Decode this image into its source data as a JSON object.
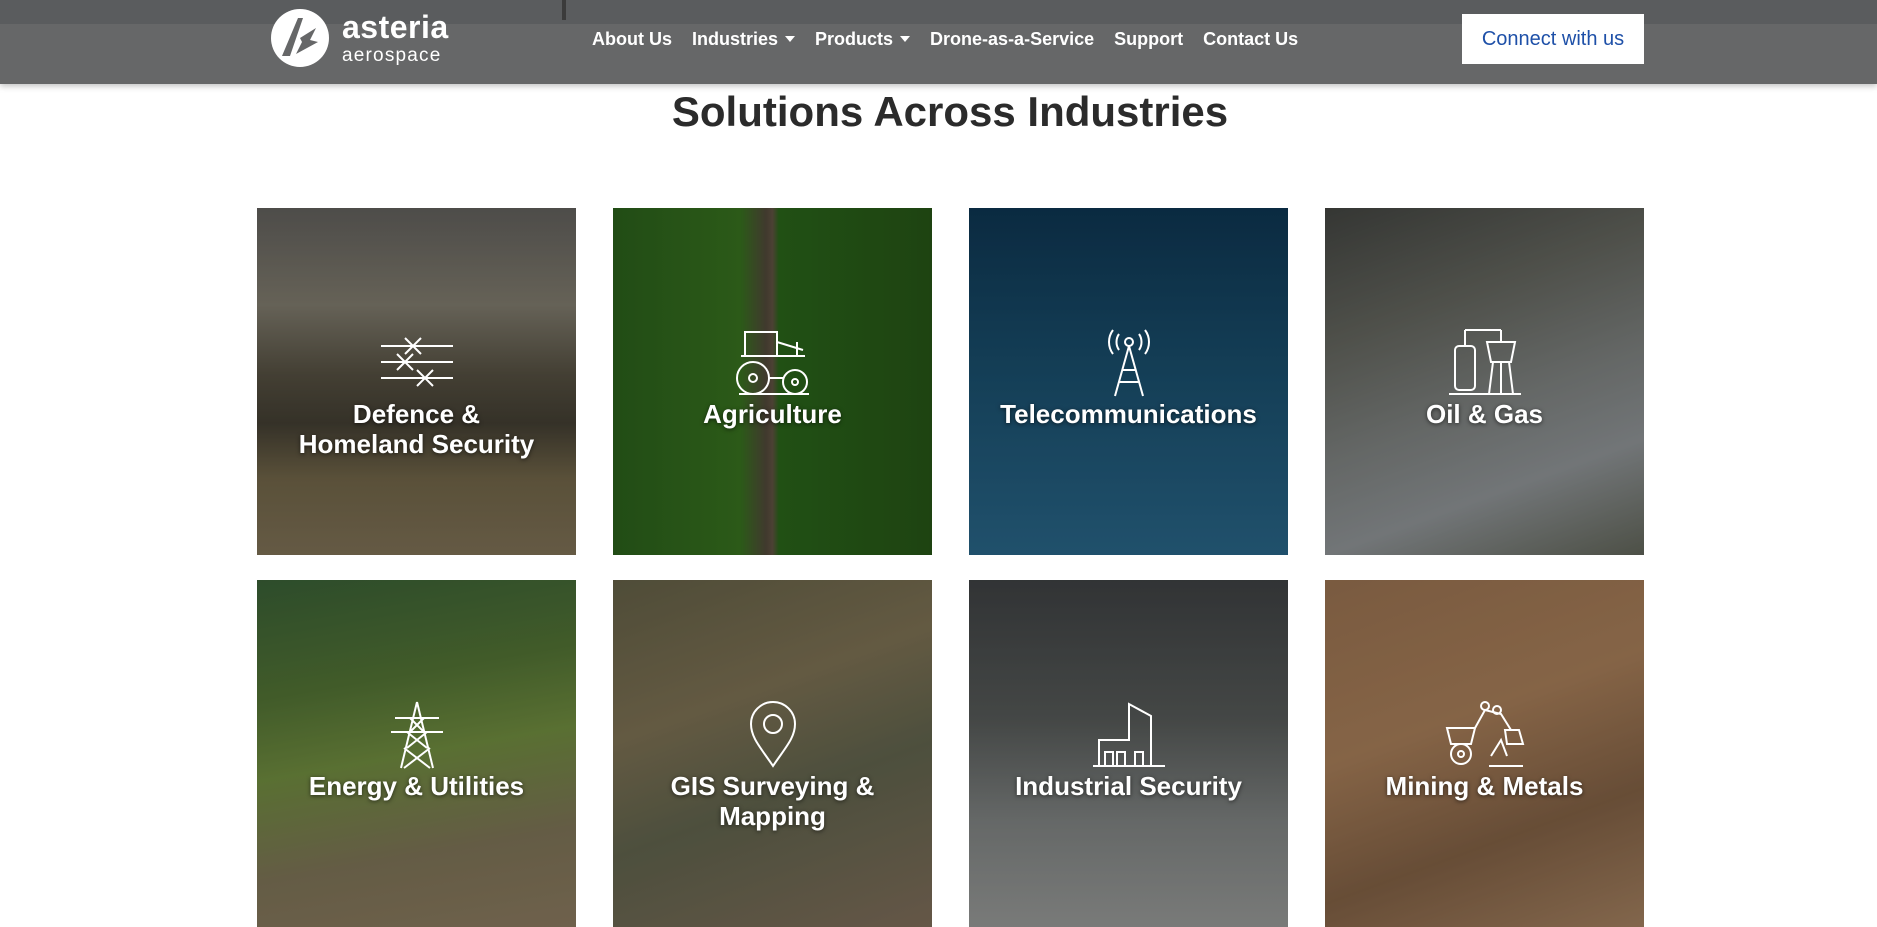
{
  "header": {
    "logo": {
      "name": "asteria",
      "sub": "aerospace"
    },
    "nav": [
      {
        "label": "About Us",
        "has_dropdown": false
      },
      {
        "label": "Industries",
        "has_dropdown": true
      },
      {
        "label": "Products",
        "has_dropdown": true
      },
      {
        "label": "Drone-as-a-Service",
        "has_dropdown": false
      },
      {
        "label": "Support",
        "has_dropdown": false
      },
      {
        "label": "Contact Us",
        "has_dropdown": false
      }
    ],
    "cta_label": "Connect with us"
  },
  "section": {
    "title": "Solutions Across Industries",
    "tiles": [
      {
        "label_line1": "Defence &",
        "label_line2": "Homeland Security",
        "icon": "barbed-wire-icon"
      },
      {
        "label_line1": "Agriculture",
        "label_line2": "",
        "icon": "tractor-icon"
      },
      {
        "label_line1": "Telecommunications",
        "label_line2": "",
        "icon": "radio-tower-icon"
      },
      {
        "label_line1": "Oil & Gas",
        "label_line2": "",
        "icon": "refinery-icon"
      },
      {
        "label_line1": "Energy & Utilities",
        "label_line2": "",
        "icon": "power-pylon-icon"
      },
      {
        "label_line1": "GIS Surveying &",
        "label_line2": "Mapping",
        "icon": "map-pin-icon"
      },
      {
        "label_line1": "Industrial Security",
        "label_line2": "",
        "icon": "factory-icon"
      },
      {
        "label_line1": "Mining & Metals",
        "label_line2": "",
        "icon": "excavator-icon"
      }
    ]
  },
  "colors": {
    "header_bg": "#666768",
    "cta_text": "#1e50a8",
    "title_text": "#2b2b2b"
  }
}
